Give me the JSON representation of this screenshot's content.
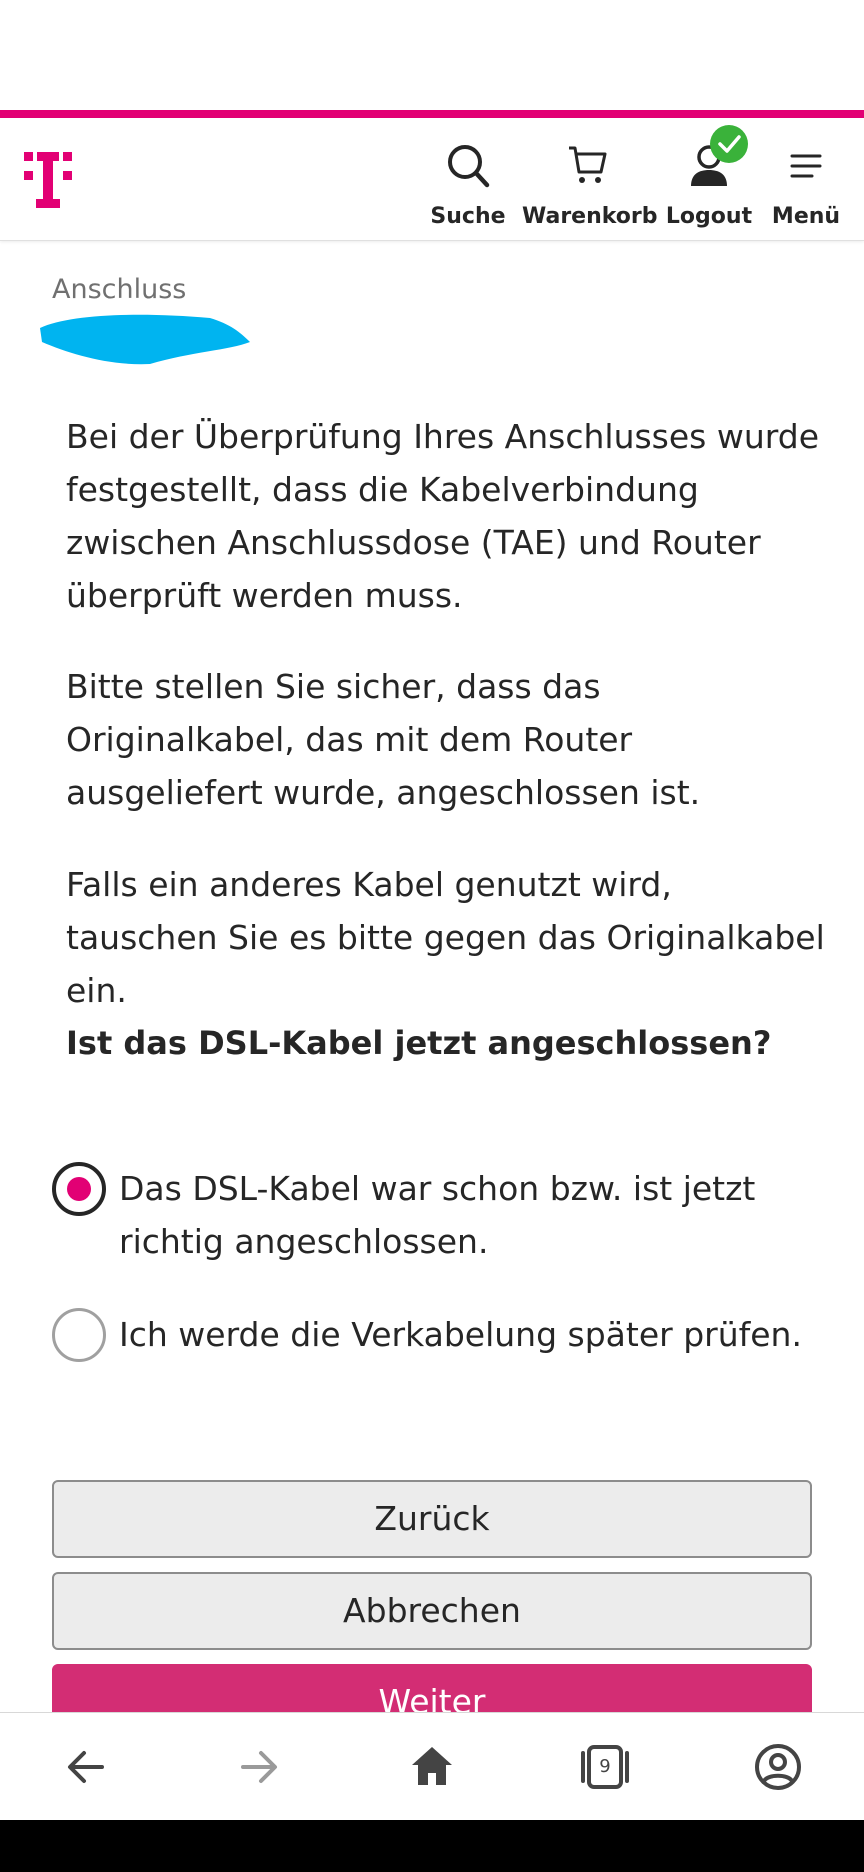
{
  "header": {
    "nav": [
      {
        "label": "Suche",
        "icon": "search-icon"
      },
      {
        "label": "Warenkorb",
        "icon": "cart-icon"
      },
      {
        "label": "Logout",
        "icon": "user-icon"
      },
      {
        "label": "Menü",
        "icon": "menu-icon"
      }
    ],
    "logo_icon": "telekom-logo",
    "logged_in_badge_icon": "checkmark-icon"
  },
  "section": {
    "label": "Anschluss"
  },
  "content": {
    "paragraphs": [
      "Bei der Überprüfung Ihres Anschlusses wurde festgestellt, dass die Kabelverbindung zwischen Anschlussdose (TAE) und Router überprüft werden muss.",
      "Bitte stellen Sie sicher, dass das Originalkabel, das mit dem Router ausgeliefert wurde, angeschlossen ist.",
      "Falls ein anderes Kabel genutzt wird, tauschen Sie es bitte gegen das Originalkabel ein."
    ],
    "question": "Ist das DSL-Kabel jetzt angeschlossen?"
  },
  "options": [
    {
      "label": "Das DSL-Kabel war schon bzw. ist jetzt richtig angeschlossen.",
      "selected": true
    },
    {
      "label": "Ich werde die Verkabelung später prüfen.",
      "selected": false
    }
  ],
  "buttons": {
    "back": "Zurück",
    "cancel": "Abbrechen",
    "next": "Weiter"
  },
  "browser_bar": {
    "tab_count": "9",
    "icons": [
      "back-arrow-icon",
      "forward-arrow-icon",
      "home-icon",
      "tabs-icon",
      "account-icon"
    ]
  },
  "colors": {
    "brand_magenta": "#e20074",
    "button_primary": "#d32d74",
    "badge_green": "#3ab23a",
    "redaction_blue": "#00b4f0"
  }
}
